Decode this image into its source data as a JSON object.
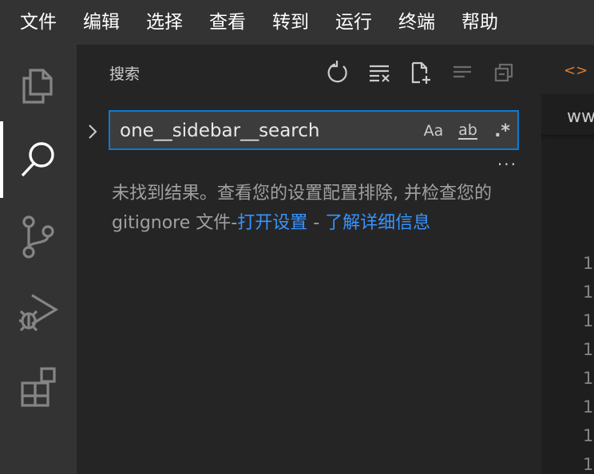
{
  "menu": [
    "文件",
    "编辑",
    "选择",
    "查看",
    "转到",
    "运行",
    "终端",
    "帮助"
  ],
  "sidebar": {
    "title": "搜索",
    "search": {
      "value": "one__sidebar__search",
      "options": {
        "match_case": "Aa",
        "whole_word": "ab",
        "regex": ".*"
      }
    },
    "more": "···",
    "message": {
      "text1": "未找到结果。查看您的设置配置排除, 并检查您的 gitignore 文件-",
      "link1": "打开设置",
      "sep": " - ",
      "link2": "了解详细信息"
    }
  },
  "editor": {
    "breadcrumb": "ww",
    "line_numbers": [
      "1",
      "1",
      "1",
      "1",
      "1",
      "1",
      "1",
      "1"
    ]
  },
  "colors": {
    "accent": "#0e7ad3",
    "link": "#3794ff",
    "menubar": "#333333",
    "sidebar": "#252526"
  }
}
